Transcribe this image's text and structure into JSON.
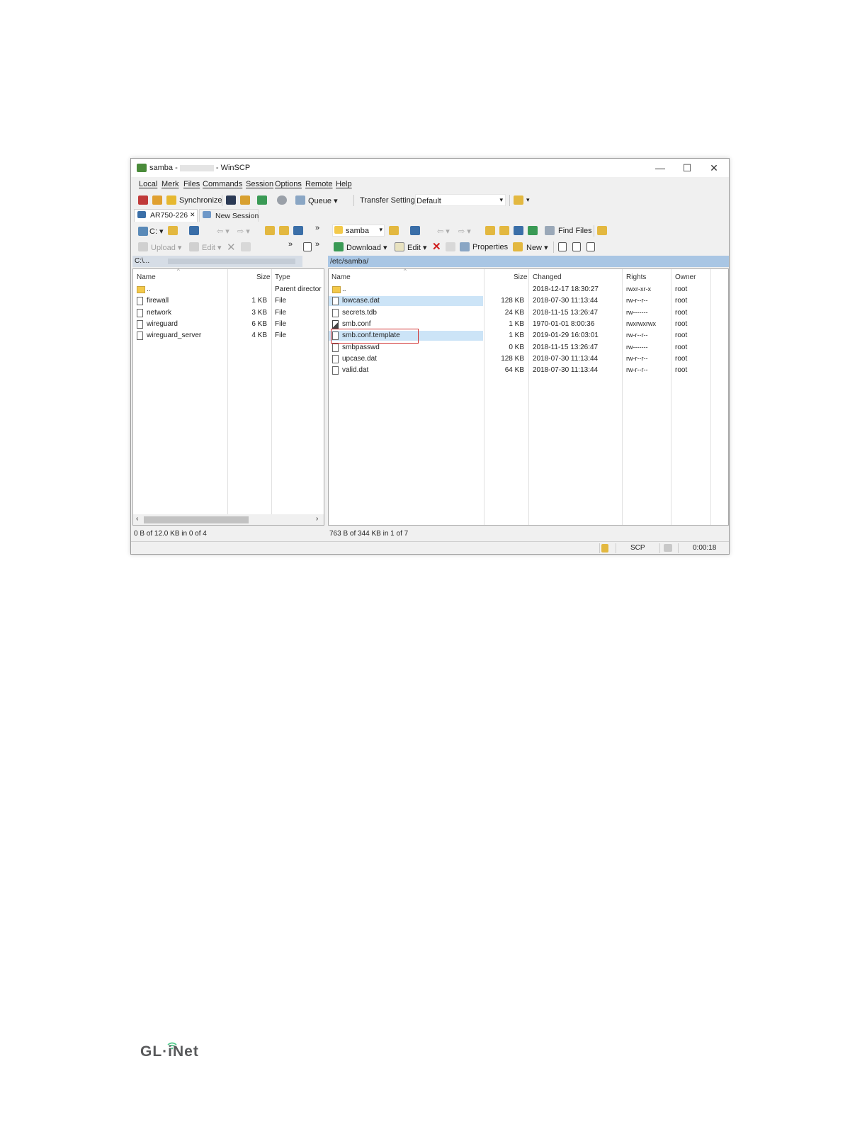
{
  "window": {
    "title_prefix": "samba -",
    "title_suffix": "- WinSCP",
    "controls": {
      "minimize": "—",
      "maximize": "☐",
      "close": "✕"
    }
  },
  "menu": [
    "Local",
    "Merk",
    "Files",
    "Commands",
    "Session",
    "Options",
    "Remote",
    "Help"
  ],
  "toolbar": {
    "synchronize": "Synchronize",
    "queue": "Queue",
    "transfer_settings_label": "Transfer Settings",
    "transfer_settings_value": "Default"
  },
  "tabs": [
    {
      "label": "AR750-226",
      "close": "✕"
    },
    {
      "label": "New Session"
    }
  ],
  "local": {
    "drive": "C:",
    "upload": "Upload",
    "edit": "Edit",
    "path": "C:\\...",
    "columns": [
      "Name",
      "Size",
      "Type"
    ],
    "rows": [
      {
        "name": "..",
        "size": "",
        "type": "Parent director",
        "icon": "folder-up"
      },
      {
        "name": "firewall",
        "size": "1 KB",
        "type": "File",
        "icon": "file"
      },
      {
        "name": "network",
        "size": "3 KB",
        "type": "File",
        "icon": "file"
      },
      {
        "name": "wireguard",
        "size": "6 KB",
        "type": "File",
        "icon": "file"
      },
      {
        "name": "wireguard_server",
        "size": "4 KB",
        "type": "File",
        "icon": "file"
      }
    ],
    "status": "0 B of 12.0 KB in 0 of 4"
  },
  "remote": {
    "folder": "samba",
    "find_files": "Find Files",
    "download": "Download",
    "edit": "Edit",
    "properties": "Properties",
    "new": "New",
    "path": "/etc/samba/",
    "columns": [
      "Name",
      "Size",
      "Changed",
      "Rights",
      "Owner"
    ],
    "rows": [
      {
        "name": "..",
        "size": "",
        "changed": "2018-12-17 18:30:27",
        "rights": "rwxr-xr-x",
        "owner": "root",
        "icon": "folder-up"
      },
      {
        "name": "lowcase.dat",
        "size": "128 KB",
        "changed": "2018-07-30 11:13:44",
        "rights": "rw-r--r--",
        "owner": "root",
        "icon": "file"
      },
      {
        "name": "secrets.tdb",
        "size": "24 KB",
        "changed": "2018-11-15 13:26:47",
        "rights": "rw-------",
        "owner": "root",
        "icon": "file"
      },
      {
        "name": "smb.conf",
        "size": "1 KB",
        "changed": "1970-01-01 8:00:36",
        "rights": "rwxrwxrwx",
        "owner": "root",
        "icon": "link"
      },
      {
        "name": "smb.conf.template",
        "size": "1 KB",
        "changed": "2019-01-29 16:03:01",
        "rights": "rw-r--r--",
        "owner": "root",
        "icon": "file"
      },
      {
        "name": "smbpasswd",
        "size": "0 KB",
        "changed": "2018-11-15 13:26:47",
        "rights": "rw-------",
        "owner": "root",
        "icon": "file"
      },
      {
        "name": "upcase.dat",
        "size": "128 KB",
        "changed": "2018-07-30 11:13:44",
        "rights": "rw-r--r--",
        "owner": "root",
        "icon": "file"
      },
      {
        "name": "valid.dat",
        "size": "64 KB",
        "changed": "2018-07-30 11:13:44",
        "rights": "rw-r--r--",
        "owner": "root",
        "icon": "file"
      }
    ],
    "selected_row": 4,
    "status": "763 B of 344 KB in 1 of 7"
  },
  "statusbar": {
    "protocol": "SCP",
    "elapsed": "0:00:18"
  },
  "colors": {
    "path_bar": "#a9c6e4",
    "selection": "#cce4f7",
    "highlight_box": "#d03030"
  },
  "logo": "GL·iNet"
}
